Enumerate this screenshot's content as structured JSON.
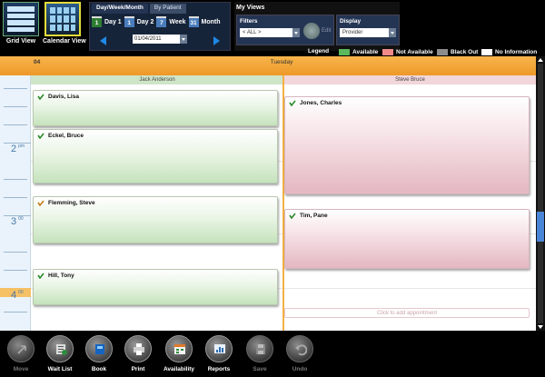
{
  "views": {
    "grid_label": "Grid View",
    "calendar_label": "Calendar View"
  },
  "period": {
    "tab_active": "Day/Week/Month",
    "tab_inactive": "By Patient",
    "day1_num": "1",
    "day1_label": "Day 1",
    "day2_num": "1",
    "day2_label": "Day 2",
    "week_num": "7",
    "week_label": "Week",
    "month_num": "31",
    "month_label": "Month",
    "date_value": "01/04/2011"
  },
  "my_views": {
    "title": "My Views",
    "filters_title": "Filters",
    "filters_value": "< ALL >",
    "edit_label": "Edit",
    "display_title": "Display",
    "display_value": "Provider"
  },
  "legend": {
    "title": "Legend",
    "items": [
      {
        "label": "Available",
        "color": "#5cb85c"
      },
      {
        "label": "Not Available",
        "color": "#f08a8a"
      },
      {
        "label": "Black Out",
        "color": "#8c8c8c"
      },
      {
        "label": "No Information",
        "color": "#ffffff"
      }
    ]
  },
  "day_header": {
    "day_number": "04",
    "day_name": "Tuesday"
  },
  "time_labels": [
    {
      "hour": "2",
      "ampm": "pm"
    },
    {
      "hour": "3",
      "ampm": "00"
    },
    {
      "hour": "4",
      "ampm": "00"
    }
  ],
  "resources": [
    {
      "name": "Jack Anderson",
      "color": "#cfe5c7"
    },
    {
      "name": "Steve Bruce",
      "color": "#f1d6da"
    }
  ],
  "appointments": [
    {
      "name": "Davis, Lisa",
      "status": "Available"
    },
    {
      "name": "Eckel, Bruce",
      "status": "Available"
    },
    {
      "name": "Flemming, Steve",
      "status": "Available"
    },
    {
      "name": "Hill, Tony",
      "status": "Available"
    },
    {
      "name": "Jones, Charles",
      "status": "Not Available"
    },
    {
      "name": "Tim, Pane",
      "status": "Not Available"
    }
  ],
  "add_appointment_hint": "Click to add appointment",
  "bottom_toolbar": [
    {
      "label": "Move",
      "icon": "move-icon",
      "enabled": false
    },
    {
      "label": "Wait List",
      "icon": "wait-list-icon",
      "enabled": true
    },
    {
      "label": "Book",
      "icon": "book-icon",
      "enabled": true
    },
    {
      "label": "Print",
      "icon": "print-icon",
      "enabled": true
    },
    {
      "label": "Availability",
      "icon": "availability-icon",
      "enabled": true
    },
    {
      "label": "Reports",
      "icon": "reports-icon",
      "enabled": true
    },
    {
      "label": "Save",
      "icon": "save-icon",
      "enabled": false
    },
    {
      "label": "Undo",
      "icon": "undo-icon",
      "enabled": false
    }
  ],
  "colors": {
    "accent_blue": "#1e88e5",
    "day_header_orange": "#f3a93b",
    "available_green": "#c5e3bc",
    "not_available_pink": "#e4b7c1"
  }
}
